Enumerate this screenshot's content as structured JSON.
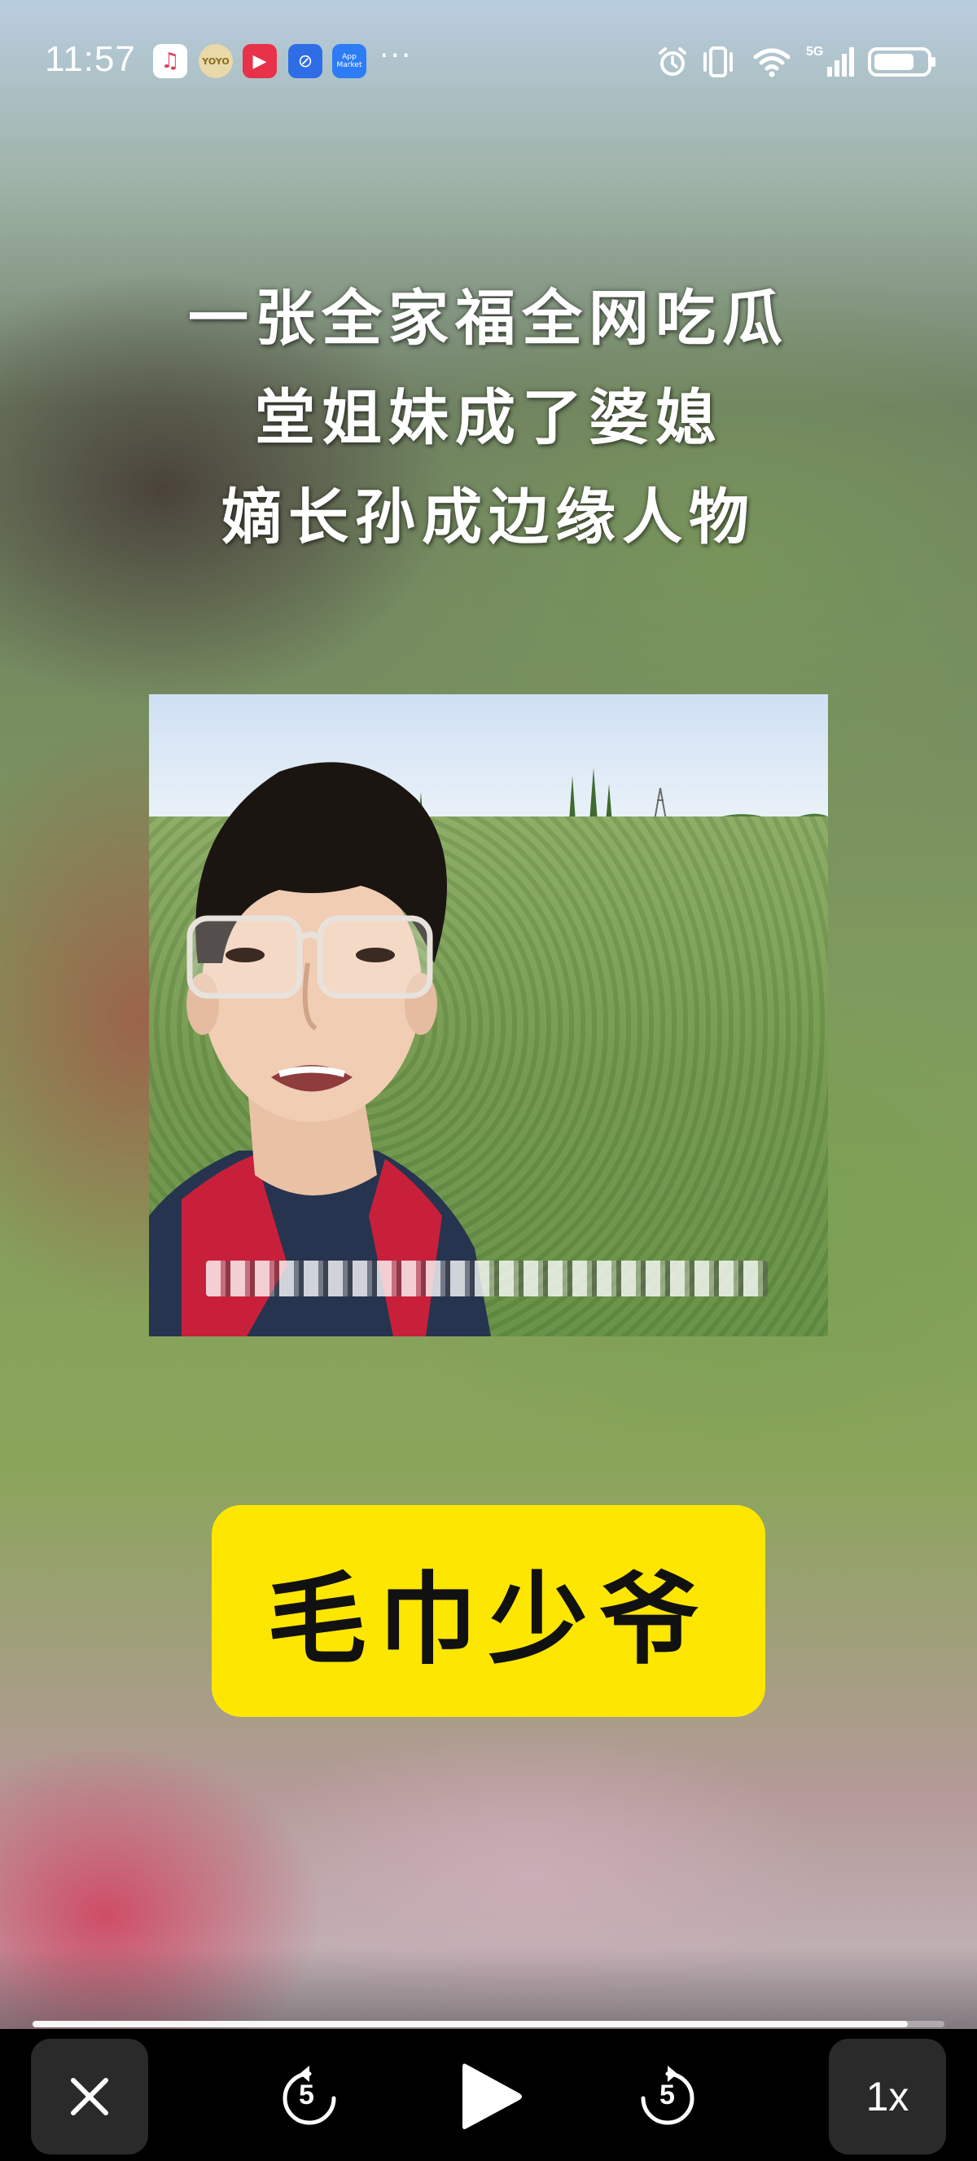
{
  "status_bar": {
    "time": "11:57",
    "apps": [
      {
        "name": "music-app-icon",
        "glyph": "♫"
      },
      {
        "name": "yoyo-app-icon",
        "glyph": "YOYO"
      },
      {
        "name": "video-app-icon",
        "glyph": "▶"
      },
      {
        "name": "browser-app-icon",
        "glyph": "⊘"
      },
      {
        "name": "app-market-icon",
        "glyph": "App Market"
      }
    ],
    "more": "···",
    "network": "5G"
  },
  "video": {
    "headline": [
      "一张全家福全网吃瓜",
      "堂姐妹成了婆媳",
      "嫡长孙成边缘人物"
    ],
    "name_tag": "毛巾少爷",
    "progress": 0.96
  },
  "controls": {
    "close_icon": "close-icon",
    "rewind_seconds": "5",
    "forward_seconds": "5",
    "speed": "1x"
  },
  "colors": {
    "name_tag_bg": "#fde600",
    "control_bar_bg": "#000000"
  }
}
